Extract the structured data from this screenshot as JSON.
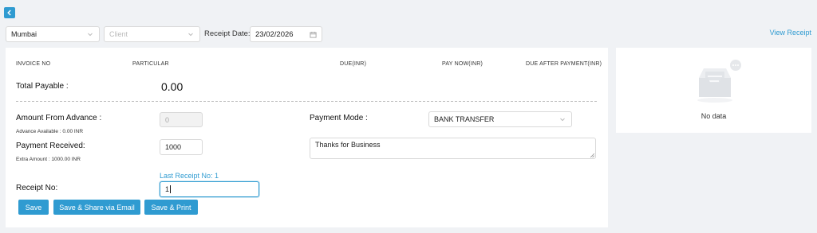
{
  "header": {
    "back_icon": "chevron-left-icon",
    "location_value": "Mumbai",
    "client_placeholder": "Client",
    "receipt_date_label": "Receipt Date:",
    "receipt_date_value": "23/02/2026",
    "view_receipt_label": "View Receipt"
  },
  "table": {
    "columns": [
      "INVOICE NO",
      "PARTICULAR",
      "DUE(INR)",
      "PAY NOW(INR)",
      "DUE AFTER PAYMENT(INR)"
    ]
  },
  "form": {
    "total_payable_label": "Total Payable :",
    "total_payable_value": "0.00",
    "amount_from_advance_label": "Amount From Advance :",
    "amount_from_advance_value": "0",
    "advance_available_text": "Advance Available : 0.00 INR",
    "payment_received_label": "Payment Received:",
    "payment_received_value": "1000",
    "extra_amount_text": "Extra Amount : 1000.00 INR",
    "last_receipt_text": "Last Receipt No: 1",
    "receipt_no_label": "Receipt No:",
    "receipt_no_value": "1",
    "payment_mode_label": "Payment Mode :",
    "payment_mode_value": "BANK TRANSFER",
    "notes_value": "Thanks for Business"
  },
  "actions": {
    "save_label": "Save",
    "save_share_label": "Save & Share via Email",
    "save_print_label": "Save & Print"
  },
  "side_panel": {
    "empty_text": "No data",
    "empty_icon": "empty-inbox-icon"
  },
  "colors": {
    "accent": "#2f9bd1",
    "background": "#f0f2f5"
  }
}
